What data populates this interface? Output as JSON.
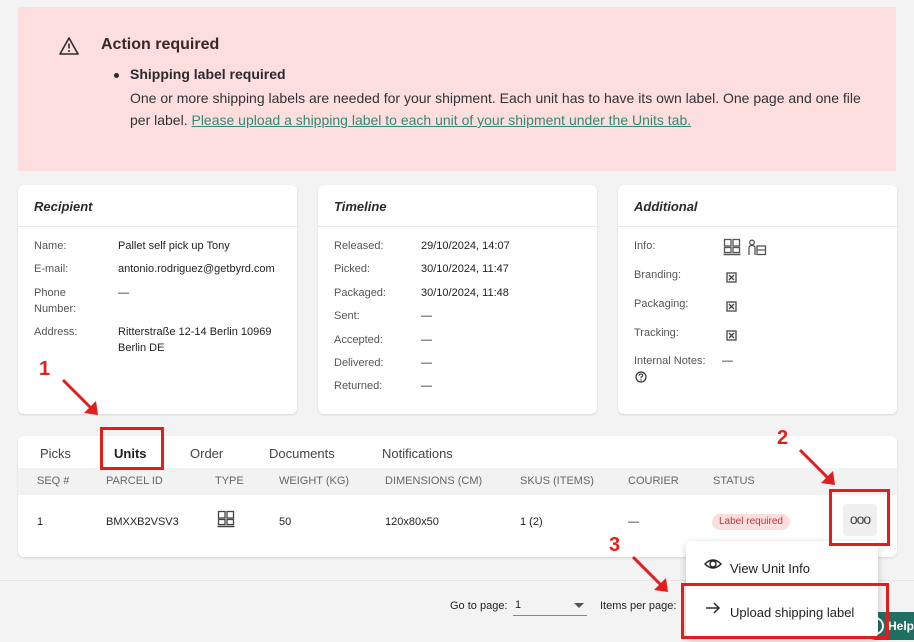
{
  "alert": {
    "title": "Action required",
    "subtitle": "Shipping label required",
    "body": "One or more shipping labels are needed for your shipment. Each unit has to have its own label. One page and one file per label. ",
    "link": "Please upload a shipping label to each unit of your shipment under the Units tab."
  },
  "recipient": {
    "title": "Recipient",
    "name_label": "Name:",
    "name": "Pallet self pick up Tony",
    "email_label": "E-mail:",
    "email": "antonio.rodriguez@getbyrd.com",
    "phone_label_1": "Phone",
    "phone_label_2": "Number:",
    "phone": "—",
    "address_label": "Address:",
    "address_1": "Ritterstraße 12-14 Berlin 10969",
    "address_2": "Berlin DE"
  },
  "timeline": {
    "title": "Timeline",
    "rows": [
      {
        "label": "Released:",
        "value": "29/10/2024, 14:07"
      },
      {
        "label": "Picked:",
        "value": "30/10/2024, 11:47"
      },
      {
        "label": "Packaged:",
        "value": "30/10/2024, 11:48"
      },
      {
        "label": "Sent:",
        "value": "—"
      },
      {
        "label": "Accepted:",
        "value": "—"
      },
      {
        "label": "Delivered:",
        "value": "—"
      },
      {
        "label": "Returned:",
        "value": "—"
      }
    ]
  },
  "additional": {
    "title": "Additional",
    "info_label": "Info:",
    "branding_label": "Branding:",
    "packaging_label": "Packaging:",
    "tracking_label": "Tracking:",
    "notes_label": "Internal Notes:",
    "notes_value": "—"
  },
  "annotations": {
    "one": "1",
    "two": "2",
    "three": "3"
  },
  "tabs": [
    "Picks",
    "Units",
    "Order",
    "Documents",
    "Notifications"
  ],
  "table": {
    "headers": [
      "SEQ #",
      "PARCEL ID",
      "TYPE",
      "WEIGHT (KG)",
      "DIMENSIONS (CM)",
      "SKUS (ITEMS)",
      "COURIER",
      "STATUS"
    ],
    "row": {
      "seq": "1",
      "parcel_id": "BMXXB2VSV3",
      "weight": "50",
      "dimensions": "120x80x50",
      "skus": "1 (2)",
      "courier": "—",
      "status": "Label required",
      "more": "ooo"
    }
  },
  "footer": {
    "goto_label": "Go to page:",
    "goto_value": "1",
    "ipp_label": "Items per page:",
    "help": "Help"
  },
  "menu": {
    "view": "View Unit Info",
    "upload": "Upload shipping label"
  },
  "colors": {
    "alert_bg": "#fddede",
    "link": "#2f8a73",
    "annotation_red": "#e01e1e",
    "badge_bg": "#fddede",
    "badge_text": "#b23b3b",
    "help_bg": "#1f6f63"
  }
}
